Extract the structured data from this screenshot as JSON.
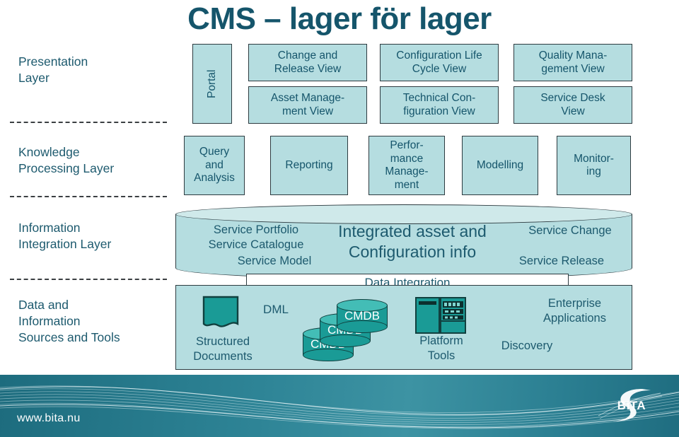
{
  "slide": {
    "title": "CMS – lager för lager",
    "title_color": "#15556b",
    "box_fill": "#b5dde0",
    "box_stroke": "#2d3b40",
    "accent_teal": "#1a9b96"
  },
  "layers": [
    {
      "id": "presentation",
      "label": "Presentation\nLayer"
    },
    {
      "id": "knowledge",
      "label": "Knowledge\nProcessing Layer"
    },
    {
      "id": "information",
      "label": "Information\nIntegration Layer"
    },
    {
      "id": "data",
      "label": "Data and\nInformation\nSources and Tools"
    }
  ],
  "presentation_layer": {
    "portal": "Portal",
    "boxes": [
      {
        "id": "change-release-view",
        "label": "Change and\nRelease View"
      },
      {
        "id": "config-life-cycle-view",
        "label": "Configuration Life\nCycle View"
      },
      {
        "id": "quality-management-view",
        "label": "Quality Mana-\ngement View"
      },
      {
        "id": "asset-management-view",
        "label": "Asset Manage-\nment View"
      },
      {
        "id": "technical-config-view",
        "label": "Technical Con-\nfiguration View"
      },
      {
        "id": "service-desk-view",
        "label": "Service Desk\nView"
      }
    ]
  },
  "knowledge_layer": {
    "boxes": [
      {
        "id": "query-and-analysis",
        "label": "Query\nand\nAnalysis"
      },
      {
        "id": "reporting",
        "label": "Reporting"
      },
      {
        "id": "performance-management",
        "label": "Perfor-\nmance\nManage-\nment"
      },
      {
        "id": "modelling",
        "label": "Modelling"
      },
      {
        "id": "monitoring",
        "label": "Monitor-\ning"
      }
    ]
  },
  "information_layer": {
    "left_lines": "Service Portfolio\nService Catalogue",
    "service_model": "Service Model",
    "center": "Integrated asset and\nConfiguration info",
    "right_top": "Service Change",
    "right_bottom": "Service Release",
    "data_integration": "Data Integration"
  },
  "data_layer": {
    "structured_documents": "Structured\nDocuments",
    "dml": "DML",
    "cmdb": "CMDB",
    "cmdb_count": 3,
    "platform_tools": "Platform\nTools",
    "enterprise_applications": "Enterprise\nApplications",
    "discovery": "Discovery"
  },
  "footer": {
    "url": "www.bita.nu",
    "logo": "BiTA"
  }
}
